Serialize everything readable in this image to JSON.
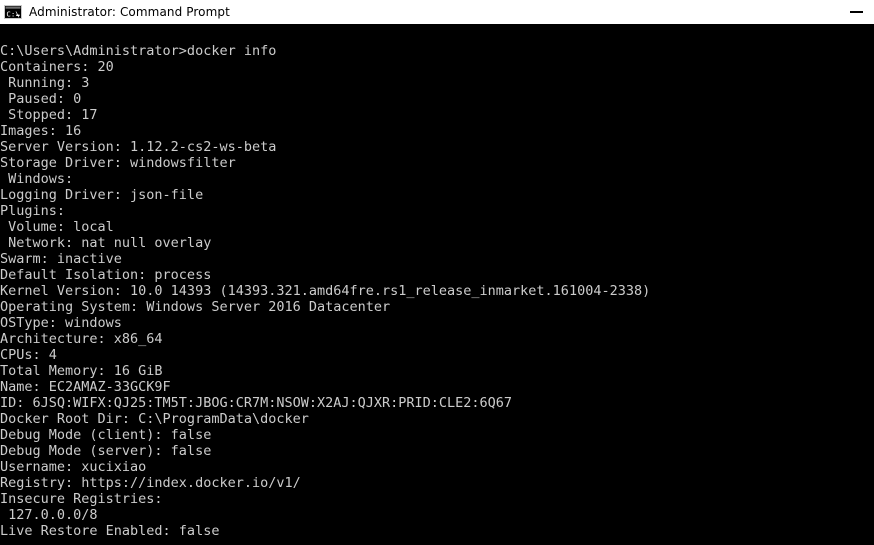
{
  "window": {
    "title": "Administrator: Command Prompt",
    "icon": "console-icon",
    "minimize_label": "Minimize",
    "titlebar_bg": "#ffffff",
    "titlebar_fg": "#000000",
    "terminal_bg": "#000000",
    "terminal_fg": "#cccccc"
  },
  "terminal": {
    "prompt_line": "C:\\Users\\Administrator>docker info",
    "lines": [
      "C:\\Users\\Administrator>docker info",
      "Containers: 20",
      " Running: 3",
      " Paused: 0",
      " Stopped: 17",
      "Images: 16",
      "Server Version: 1.12.2-cs2-ws-beta",
      "Storage Driver: windowsfilter",
      " Windows:",
      "Logging Driver: json-file",
      "Plugins:",
      " Volume: local",
      " Network: nat null overlay",
      "Swarm: inactive",
      "Default Isolation: process",
      "Kernel Version: 10.0 14393 (14393.321.amd64fre.rs1_release_inmarket.161004-2338)",
      "Operating System: Windows Server 2016 Datacenter",
      "OSType: windows",
      "Architecture: x86_64",
      "CPUs: 4",
      "Total Memory: 16 GiB",
      "Name: EC2AMAZ-33GCK9F",
      "ID: 6JSQ:WIFX:QJ25:TM5T:JBOG:CR7M:NSOW:X2AJ:QJXR:PRID:CLE2:6Q67",
      "Docker Root Dir: C:\\ProgramData\\docker",
      "Debug Mode (client): false",
      "Debug Mode (server): false",
      "Username: xucixiao",
      "Registry: https://index.docker.io/v1/",
      "Insecure Registries:",
      " 127.0.0.0/8",
      "Live Restore Enabled: false"
    ]
  }
}
